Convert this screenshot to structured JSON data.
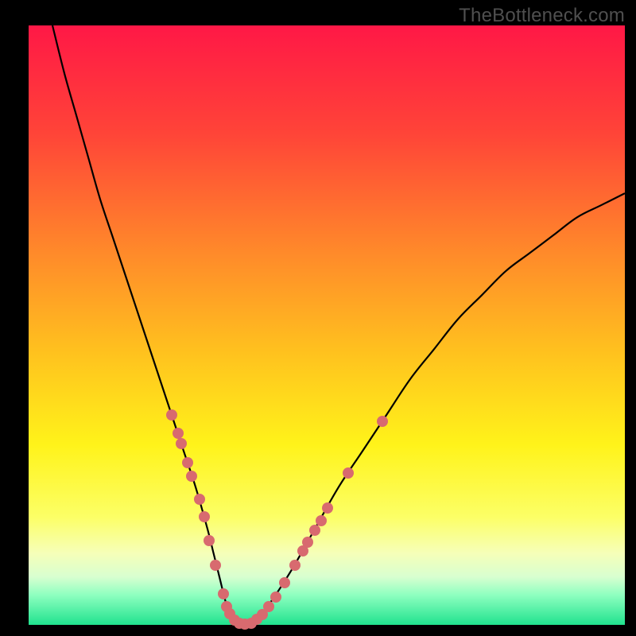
{
  "watermark": "TheBottleneck.com",
  "colors": {
    "dot": "#d86a6f",
    "curve": "#000000",
    "gradient_stops": [
      {
        "pct": 0,
        "color": "#ff1846"
      },
      {
        "pct": 18,
        "color": "#ff4438"
      },
      {
        "pct": 38,
        "color": "#ff8a2a"
      },
      {
        "pct": 55,
        "color": "#ffc31e"
      },
      {
        "pct": 70,
        "color": "#fff31a"
      },
      {
        "pct": 82,
        "color": "#fcff66"
      },
      {
        "pct": 88,
        "color": "#f6ffb8"
      },
      {
        "pct": 92,
        "color": "#d8ffd0"
      },
      {
        "pct": 95,
        "color": "#8effc0"
      },
      {
        "pct": 100,
        "color": "#20e28e"
      }
    ]
  },
  "chart_data": {
    "type": "line",
    "title": "",
    "xlabel": "",
    "ylabel": "",
    "xlim": [
      0,
      100
    ],
    "ylim": [
      0,
      100
    ],
    "grid": false,
    "series": [
      {
        "name": "curve",
        "x": [
          4,
          6,
          8,
          10,
          12,
          14,
          16,
          18,
          20,
          22,
          24,
          26,
          28,
          30,
          31,
          32,
          33,
          34,
          36,
          38,
          40,
          44,
          48,
          52,
          56,
          60,
          64,
          68,
          72,
          76,
          80,
          84,
          88,
          92,
          96,
          100
        ],
        "y": [
          100,
          92,
          85,
          78,
          71,
          65,
          59,
          53,
          47,
          41,
          35,
          29,
          23,
          16,
          12,
          8,
          4,
          1,
          0,
          1,
          3,
          9,
          16,
          23,
          29,
          35,
          41,
          46,
          51,
          55,
          59,
          62,
          65,
          68,
          70,
          72
        ]
      }
    ],
    "dots": [
      {
        "x": 24.0,
        "y": 35.0
      },
      {
        "x": 25.0,
        "y": 32.0
      },
      {
        "x": 25.6,
        "y": 30.2
      },
      {
        "x": 26.7,
        "y": 27.0
      },
      {
        "x": 27.3,
        "y": 24.8
      },
      {
        "x": 28.6,
        "y": 21.0
      },
      {
        "x": 29.4,
        "y": 18.0
      },
      {
        "x": 30.3,
        "y": 14.0
      },
      {
        "x": 31.3,
        "y": 10.0
      },
      {
        "x": 32.6,
        "y": 5.2
      },
      {
        "x": 33.2,
        "y": 3.0
      },
      {
        "x": 33.7,
        "y": 1.8
      },
      {
        "x": 34.5,
        "y": 0.8
      },
      {
        "x": 35.3,
        "y": 0.3
      },
      {
        "x": 36.3,
        "y": 0.1
      },
      {
        "x": 37.3,
        "y": 0.3
      },
      {
        "x": 38.3,
        "y": 0.9
      },
      {
        "x": 39.2,
        "y": 1.7
      },
      {
        "x": 40.3,
        "y": 3.0
      },
      {
        "x": 41.4,
        "y": 4.6
      },
      {
        "x": 42.9,
        "y": 7.0
      },
      {
        "x": 44.7,
        "y": 10.0
      },
      {
        "x": 46.0,
        "y": 12.3
      },
      {
        "x": 46.8,
        "y": 13.8
      },
      {
        "x": 48.0,
        "y": 15.8
      },
      {
        "x": 49.0,
        "y": 17.4
      },
      {
        "x": 50.1,
        "y": 19.5
      },
      {
        "x": 53.6,
        "y": 25.3
      },
      {
        "x": 59.3,
        "y": 34.0
      }
    ]
  }
}
